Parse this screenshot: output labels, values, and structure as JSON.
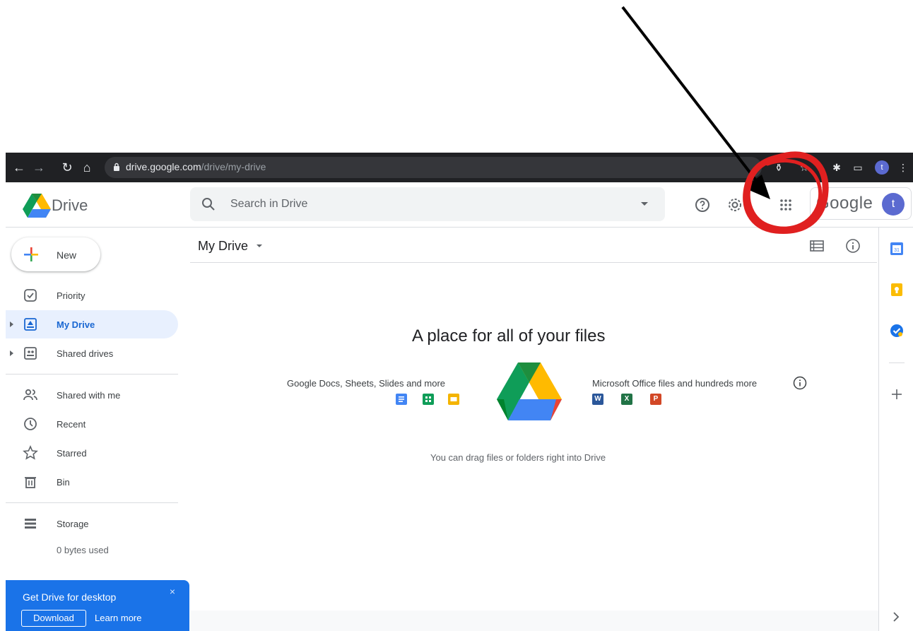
{
  "browser": {
    "url_host": "drive.google.com",
    "url_path": "/drive/my-drive",
    "profile_initial": "t"
  },
  "header": {
    "app_name": "Drive",
    "search_placeholder": "Search in Drive",
    "account_brand": "Google",
    "account_initial": "t"
  },
  "sidebar": {
    "new_label": "New",
    "items": [
      {
        "label": "Priority",
        "icon": "priority-check-icon"
      },
      {
        "label": "My Drive",
        "icon": "my-drive-icon",
        "active": true
      },
      {
        "label": "Shared drives",
        "icon": "shared-drives-icon"
      },
      {
        "label": "Shared with me",
        "icon": "people-icon"
      },
      {
        "label": "Recent",
        "icon": "clock-icon"
      },
      {
        "label": "Starred",
        "icon": "star-icon"
      },
      {
        "label": "Bin",
        "icon": "trash-icon"
      },
      {
        "label": "Storage",
        "icon": "storage-icon"
      }
    ],
    "storage_used": "0 bytes used"
  },
  "promo": {
    "title": "Get Drive for desktop",
    "download_label": "Download",
    "learn_more_label": "Learn more",
    "close_glyph": "×"
  },
  "main": {
    "title": "My Drive",
    "empty_title": "A place for all of your files",
    "google_formats_label": "Google Docs, Sheets, Slides and more",
    "ms_formats_label": "Microsoft Office files and hundreds more",
    "drag_hint": "You can drag files or folders right into Drive",
    "ms_icon_letters": {
      "word": "W",
      "excel": "X",
      "powerpoint": "P"
    }
  },
  "colors": {
    "accent": "#1a73e8",
    "active_nav_bg": "#e8f0fe",
    "annotation_red": "#e02020"
  }
}
